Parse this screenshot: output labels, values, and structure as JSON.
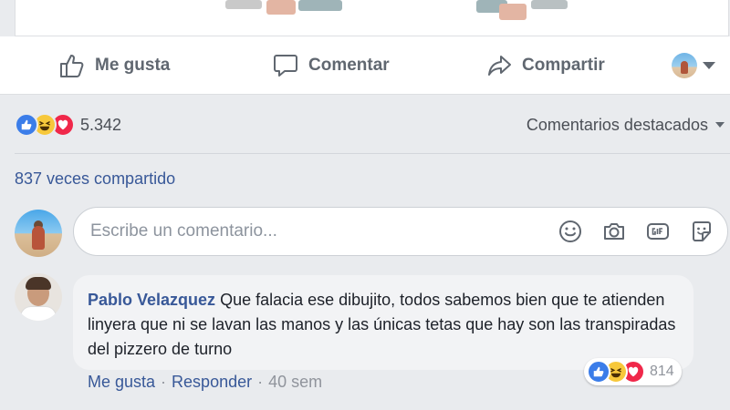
{
  "post_actions": {
    "like_label": "Me gusta",
    "comment_label": "Comentar",
    "share_label": "Compartir"
  },
  "reactions": {
    "icons": [
      "like-icon",
      "haha-icon",
      "love-icon"
    ],
    "count": "5.342"
  },
  "sort": {
    "label": "Comentarios destacados"
  },
  "shares": {
    "label": "837 veces compartido"
  },
  "composer": {
    "placeholder": "Escribe un comentario...",
    "icons": [
      "emoji-icon",
      "camera-icon",
      "gif-icon",
      "sticker-icon"
    ]
  },
  "comment": {
    "author": "Pablo Velazquez",
    "text": "Que falacia ese dibujito, todos sabemos bien que te atienden linyera que ni se lavan las manos y las únicas tetas que hay son las transpiradas del pizzero de turno",
    "like_label": "Me gusta",
    "reply_label": "Responder",
    "age": "40 sem",
    "reaction_count": "814",
    "separator": "·"
  },
  "colors": {
    "link_blue": "#385898",
    "like_blue": "#3b7de9",
    "haha_yellow": "#f7c83b",
    "love_red": "#f0284a",
    "page_bg": "#e9ebee"
  }
}
